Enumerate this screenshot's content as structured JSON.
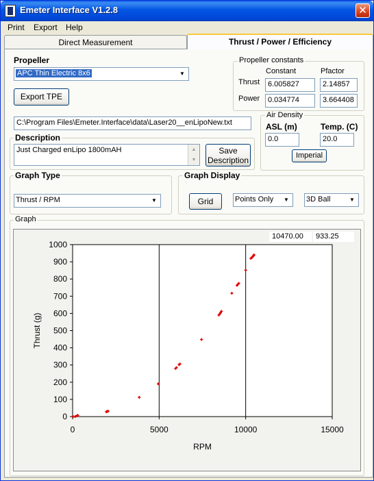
{
  "window": {
    "title": "Emeter Interface V1.2.8",
    "close_glyph": "✕"
  },
  "menu": [
    "Print",
    "Export",
    "Help"
  ],
  "tabs": [
    {
      "label": "Direct Measurement",
      "active": false
    },
    {
      "label": "Thrust / Power / Efficiency",
      "active": true
    }
  ],
  "propeller": {
    "label": "Propeller",
    "selected": "APC Thin Electric 8x6",
    "export_button": "Export TPE"
  },
  "constants": {
    "label": "Propeller constants",
    "col_constant": "Constant",
    "col_pfactor": "Pfactor",
    "rows": [
      {
        "label": "Thrust",
        "constant": "6.005827",
        "pfactor": "2.14857"
      },
      {
        "label": "Power",
        "constant": "0.034774",
        "pfactor": "3.664408"
      }
    ]
  },
  "file_path": "C:\\Program Files\\Emeter.Interface\\data\\Laser20__enLipoNew.txt",
  "description": {
    "label": "Description",
    "text": "Just Charged enLipo 1800mAH",
    "save_button_line1": "Save",
    "save_button_line2": "Description"
  },
  "air_density": {
    "label": "Air Density",
    "asl_label": "ASL (m)",
    "asl_value": "0.0",
    "temp_label": "Temp. (C)",
    "temp_value": "20.0",
    "imperial_button": "Imperial"
  },
  "graph_type": {
    "label": "Graph Type",
    "selected": "Thrust / RPM"
  },
  "graph_display": {
    "label": "Graph Display",
    "grid_button": "Grid",
    "points_selected": "Points Only",
    "style_selected": "3D Ball"
  },
  "graph": {
    "label": "Graph",
    "cursor_x": "10470.00",
    "cursor_y": "933.25"
  },
  "colors": {
    "points": "#E00000",
    "title_bar": "#0A5FE8",
    "accent": "#FFC83C"
  },
  "chart_data": {
    "type": "scatter",
    "xlabel": "RPM",
    "ylabel": "Thrust (g)",
    "xlim": [
      0,
      15000
    ],
    "ylim": [
      0,
      1000
    ],
    "xticks": [
      0,
      5000,
      10000,
      15000
    ],
    "yticks": [
      0,
      100,
      200,
      300,
      400,
      500,
      600,
      700,
      800,
      900,
      1000
    ],
    "grid": true,
    "x": [
      30,
      150,
      250,
      300,
      1950,
      2000,
      2050,
      3850,
      4950,
      5950,
      6000,
      6150,
      6200,
      7450,
      8450,
      8500,
      8550,
      8600,
      9200,
      9500,
      9550,
      9600,
      10000,
      10300,
      10350,
      10400,
      10450,
      10480
    ],
    "y": [
      0,
      0,
      5,
      7,
      28,
      30,
      32,
      112,
      190,
      280,
      285,
      302,
      306,
      448,
      590,
      597,
      604,
      612,
      717,
      763,
      769,
      775,
      851,
      920,
      925,
      930,
      935,
      940
    ]
  }
}
